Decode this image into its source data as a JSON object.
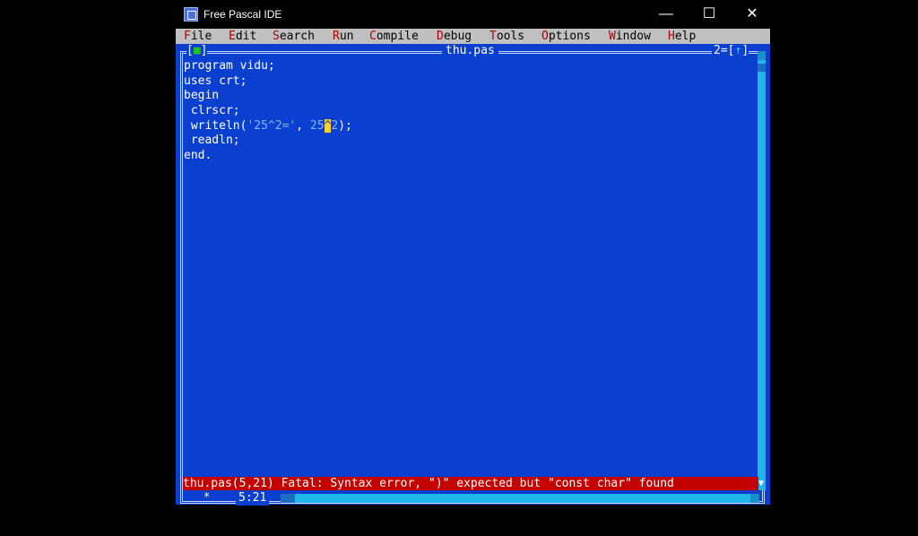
{
  "window": {
    "title": "Free Pascal IDE",
    "min_glyph": "—",
    "max_glyph": "☐",
    "close_glyph": "✕"
  },
  "menu": {
    "items": [
      {
        "hotkey": "F",
        "rest": "ile"
      },
      {
        "hotkey": "E",
        "rest": "dit"
      },
      {
        "hotkey": "S",
        "rest": "earch"
      },
      {
        "hotkey": "R",
        "rest": "un"
      },
      {
        "hotkey": "C",
        "rest": "ompile"
      },
      {
        "hotkey": "D",
        "rest": "ebug"
      },
      {
        "hotkey": "T",
        "rest": "ools"
      },
      {
        "hotkey": "O",
        "rest": "ptions"
      },
      {
        "hotkey": "W",
        "rest": "indow"
      },
      {
        "hotkey": "H",
        "rest": "elp"
      }
    ]
  },
  "editor": {
    "filename": "thu.pas",
    "close_box_left": "[",
    "close_box_square": "■",
    "close_box_right": "]",
    "window_number": "2=[",
    "zoom_glyph": "↑",
    "zoom_right": "]",
    "lines": {
      "l1": "program vidu;",
      "l2": "uses crt;",
      "l3": "begin",
      "l4": " clrscr;",
      "l5_a": " writeln(",
      "l5_str": "'25^2='",
      "l5_b": ", ",
      "l5_num": "25",
      "l5_cursor": "^",
      "l5_num2": "2",
      "l5_c": ");",
      "l6": " readln;",
      "l7": "end."
    },
    "error_message": "thu.pas(5,21) Fatal: Syntax error, \")\" expected but \"const char\" found",
    "modified_indicator": "*",
    "cursor_position": "5:21",
    "scroll_down_glyph": "▼"
  },
  "colors": {
    "editor_bg": "#0a3fd0",
    "menubar_bg": "#c0c0c0",
    "error_bg": "#c40000",
    "scrollbar": "#1fb6e8"
  }
}
